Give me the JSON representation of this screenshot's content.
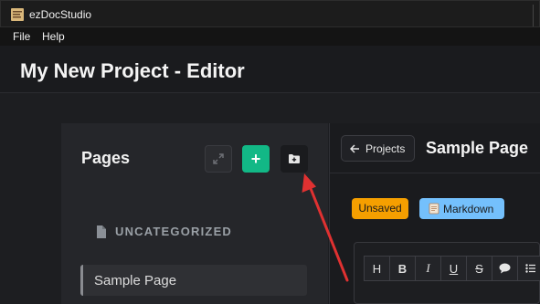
{
  "window": {
    "title": "ezDocStudio"
  },
  "menu": {
    "file": "File",
    "help": "Help"
  },
  "header": {
    "title": "My New Project - Editor"
  },
  "pages_panel": {
    "title": "Pages",
    "buttons": {
      "expand_icon": "expand-icon",
      "add_label": "+",
      "folder_icon": "folder-plus-icon"
    },
    "category": {
      "icon": "file-icon",
      "label": "UNCATEGORIZED"
    },
    "items": [
      {
        "label": "Sample Page"
      }
    ]
  },
  "editor": {
    "back_button": {
      "icon": "arrow-left-icon",
      "label": "Projects"
    },
    "page_title": "Sample Page",
    "badges": {
      "unsaved": "Unsaved",
      "markdown": "Markdown",
      "markdown_icon": "note-icon"
    },
    "toolbar": {
      "bold": "B",
      "italic": "I",
      "underline": "U",
      "strike": "S",
      "comment_icon": "comment-icon",
      "list_icon": "list-icon"
    }
  },
  "annotation": {
    "color": "#e03131",
    "target": "folder-plus-button"
  },
  "colors": {
    "accent_green": "#12b886",
    "badge_orange": "#f59f00",
    "badge_blue": "#74c0fc",
    "background": "#1e1f22"
  }
}
